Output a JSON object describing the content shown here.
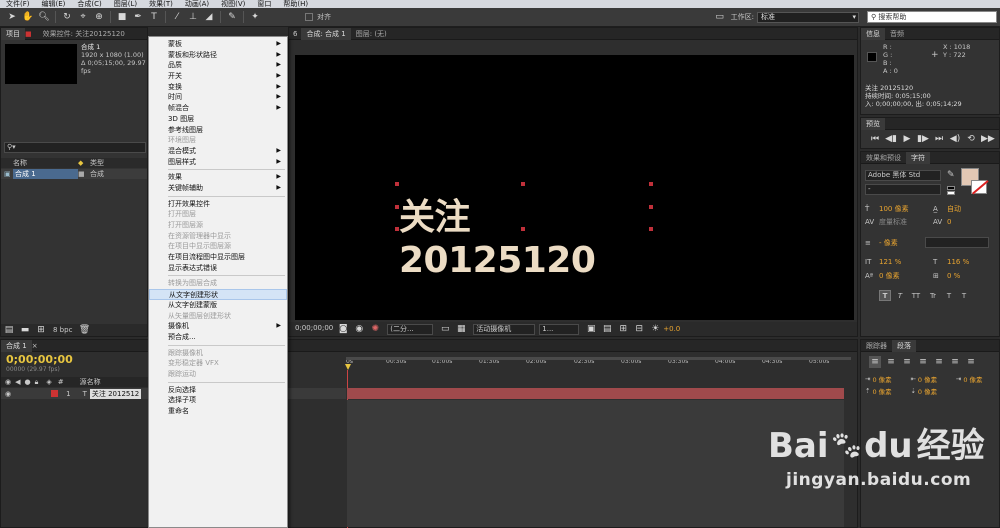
{
  "menubar": {
    "items": [
      "文件(F)",
      "编辑(E)",
      "合成(C)",
      "图层(L)",
      "效果(T)",
      "动画(A)",
      "视图(V)",
      "窗口",
      "帮助(H)"
    ]
  },
  "toolbar": {
    "snap_label": "对齐",
    "workspace_label": "工作区:",
    "workspace_value": "标准",
    "help_search_placeholder": "搜索帮助"
  },
  "project_panel": {
    "tab_project": "项目",
    "tab_effects": "效果控件: 关注20125120",
    "comp_name": "合成 1",
    "comp_dims": "1920 x 1080 (1.00)",
    "comp_duration": "Δ 0;05;15;00, 29.97 fps",
    "col_name": "名称",
    "col_type": "类型",
    "row_name": "合成 1",
    "row_type": "合成",
    "bpc": "8 bpc"
  },
  "comp_panel": {
    "tab_comp": "合成: 合成 1",
    "tab_layer": "图层: (无)",
    "comp_text": "关注20125120",
    "timecode": "0;00;00;00",
    "quality": "(二分...",
    "camera": "活动摄像机",
    "views": "1...",
    "exposure": "+0.0"
  },
  "info_panel": {
    "tab_info": "信息",
    "tab_audio": "音频",
    "r": "R :",
    "g": "G :",
    "b": "B :",
    "a": "A : 0",
    "x": "X : 1018",
    "y": "Y : 722",
    "layer_name": "关注 20125120",
    "duration": "持续时间: 0;05;15;00",
    "in_out": "入: 0;00;00;00, 出: 0;05;14;29"
  },
  "preview_panel": {
    "tab": "预览"
  },
  "char_panel": {
    "tab_effects": "效果和预设",
    "tab_char": "字符",
    "font_name": "Adobe 黑体 Std",
    "font_style": "-",
    "size": "100 像素",
    "leading": "自动",
    "kerning": "度量标准",
    "tracking": "0",
    "stroke": "- 像素",
    "vscale": "121 %",
    "hscale": "116 %",
    "baseline": "0 像素",
    "tsume": "0 %",
    "style_buttons": [
      "T",
      "T",
      "TT",
      "Tr",
      "T",
      "T"
    ]
  },
  "para_panel": {
    "tab_tracker": "跟踪器",
    "tab_para": "段落",
    "indent_values": [
      "0 像素",
      "0 像素",
      "0 像素",
      "0 像素",
      "0 像素"
    ]
  },
  "timeline": {
    "tab": "合成 1",
    "timecode": "0;00;00;00",
    "fps": "00000 (29.97 fps)",
    "col_source": "源名称",
    "layer_num": "1",
    "layer_name": "关注 2012512",
    "ruler": [
      "0s",
      "00:30s",
      "01:00s",
      "01:30s",
      "02:00s",
      "02:30s",
      "03:00s",
      "03:30s",
      "04:00s",
      "04:30s",
      "05:00s"
    ]
  },
  "context_menu": {
    "items": [
      {
        "label": "蒙板",
        "sub": true,
        "dis": false
      },
      {
        "label": "蒙板和形状路径",
        "sub": true,
        "dis": false
      },
      {
        "label": "品质",
        "sub": true,
        "dis": false
      },
      {
        "label": "开关",
        "sub": true,
        "dis": false
      },
      {
        "label": "变换",
        "sub": true,
        "dis": false
      },
      {
        "label": "时间",
        "sub": true,
        "dis": false
      },
      {
        "label": "帧混合",
        "sub": true,
        "dis": false
      },
      {
        "label": "3D 图层",
        "sub": false,
        "dis": false
      },
      {
        "label": "参考线图层",
        "sub": false,
        "dis": false
      },
      {
        "label": "环境图层",
        "sub": false,
        "dis": true
      },
      {
        "label": "混合模式",
        "sub": true,
        "dis": false
      },
      {
        "label": "图层样式",
        "sub": true,
        "dis": false
      },
      {
        "sep": true
      },
      {
        "label": "效果",
        "sub": true,
        "dis": false
      },
      {
        "label": "关键帧辅助",
        "sub": true,
        "dis": false
      },
      {
        "sep": true
      },
      {
        "label": "打开效果控件",
        "sub": false,
        "dis": false
      },
      {
        "label": "打开图层",
        "sub": false,
        "dis": true
      },
      {
        "label": "打开图层源",
        "sub": false,
        "dis": true
      },
      {
        "label": "在资源管理器中显示",
        "sub": false,
        "dis": true
      },
      {
        "label": "在项目中显示图层源",
        "sub": false,
        "dis": true
      },
      {
        "label": "在项目流程图中显示图层",
        "sub": false,
        "dis": false
      },
      {
        "label": "显示表达式错误",
        "sub": false,
        "dis": false
      },
      {
        "sep": true
      },
      {
        "label": "转换为图层合成",
        "sub": false,
        "dis": true
      },
      {
        "label": "从文字创建形状",
        "sub": false,
        "dis": false,
        "hl": true
      },
      {
        "label": "从文字创建蒙版",
        "sub": false,
        "dis": false
      },
      {
        "label": "从矢量图层创建形状",
        "sub": false,
        "dis": true
      },
      {
        "label": "摄像机",
        "sub": true,
        "dis": false
      },
      {
        "label": "预合成...",
        "sub": false,
        "dis": false
      },
      {
        "sep": true
      },
      {
        "label": "跟踪摄像机",
        "sub": false,
        "dis": true
      },
      {
        "label": "变形稳定器 VFX",
        "sub": false,
        "dis": true
      },
      {
        "label": "跟踪运动",
        "sub": false,
        "dis": true
      },
      {
        "sep": true
      },
      {
        "label": "反向选择",
        "sub": false,
        "dis": false
      },
      {
        "label": "选择子项",
        "sub": false,
        "dis": false
      },
      {
        "label": "重命名",
        "sub": false,
        "dis": false
      }
    ]
  },
  "watermark": {
    "brand": "Bai",
    "brand2": "du",
    "cn": "经验",
    "url": "jingyan.baidu.com"
  }
}
